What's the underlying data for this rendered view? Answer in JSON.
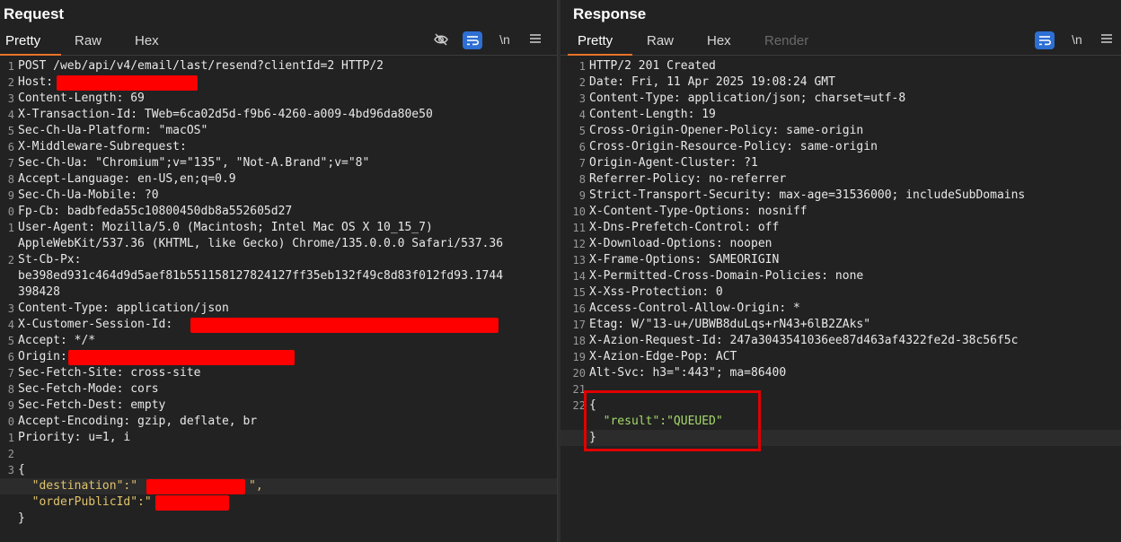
{
  "request": {
    "title": "Request",
    "tabs": [
      "Pretty",
      "Raw",
      "Hex"
    ],
    "newline_toggle": "\\n",
    "lines": [
      {
        "n": "1",
        "t": "POST /web/api/v4/email/last/resend?clientId=2 HTTP/2"
      },
      {
        "n": "2",
        "t": "Host:"
      },
      {
        "n": "3",
        "t": "Content-Length: 69"
      },
      {
        "n": "4",
        "t": "X-Transaction-Id: TWeb=6ca02d5d-f9b6-4260-a009-4bd96da80e50"
      },
      {
        "n": "5",
        "t": "Sec-Ch-Ua-Platform: \"macOS\""
      },
      {
        "n": "6",
        "t": "X-Middleware-Subrequest:"
      },
      {
        "n": "7",
        "t": "Sec-Ch-Ua: \"Chromium\";v=\"135\", \"Not-A.Brand\";v=\"8\""
      },
      {
        "n": "8",
        "t": "Accept-Language: en-US,en;q=0.9"
      },
      {
        "n": "9",
        "t": "Sec-Ch-Ua-Mobile: ?0"
      },
      {
        "n": "0",
        "t": "Fp-Cb: badbfeda55c10800450db8a552605d27"
      },
      {
        "n": "1",
        "t": "User-Agent: Mozilla/5.0 (Macintosh; Intel Mac OS X 10_15_7)"
      },
      {
        "n": "",
        "t": "AppleWebKit/537.36 (KHTML, like Gecko) Chrome/135.0.0.0 Safari/537.36"
      },
      {
        "n": "2",
        "t": "St-Cb-Px:"
      },
      {
        "n": "",
        "t": "be398ed931c464d9d5aef81b551158127824127ff35eb132f49c8d83f012fd93.1744"
      },
      {
        "n": "",
        "t": "398428"
      },
      {
        "n": "3",
        "t": "Content-Type: application/json"
      },
      {
        "n": "4",
        "t": "X-Customer-Session-Id:"
      },
      {
        "n": "5",
        "t": "Accept: */*"
      },
      {
        "n": "6",
        "t": "Origin:"
      },
      {
        "n": "7",
        "t": "Sec-Fetch-Site: cross-site"
      },
      {
        "n": "8",
        "t": "Sec-Fetch-Mode: cors"
      },
      {
        "n": "9",
        "t": "Sec-Fetch-Dest: empty"
      },
      {
        "n": "0",
        "t": "Accept-Encoding: gzip, deflate, br"
      },
      {
        "n": "1",
        "t": "Priority: u=1, i"
      },
      {
        "n": "2",
        "t": ""
      },
      {
        "n": "3",
        "t": "{"
      },
      {
        "n": "",
        "t": "  \"destination\":\"",
        "tail": "\","
      },
      {
        "n": "",
        "t": "  \"orderPublicId\":\""
      },
      {
        "n": "",
        "t": "}"
      }
    ]
  },
  "response": {
    "title": "Response",
    "tabs": [
      "Pretty",
      "Raw",
      "Hex",
      "Render"
    ],
    "newline_toggle": "\\n",
    "lines": [
      {
        "n": "1",
        "t": "HTTP/2 201 Created"
      },
      {
        "n": "2",
        "t": "Date: Fri, 11 Apr 2025 19:08:24 GMT"
      },
      {
        "n": "3",
        "t": "Content-Type: application/json; charset=utf-8"
      },
      {
        "n": "4",
        "t": "Content-Length: 19"
      },
      {
        "n": "5",
        "t": "Cross-Origin-Opener-Policy: same-origin"
      },
      {
        "n": "6",
        "t": "Cross-Origin-Resource-Policy: same-origin"
      },
      {
        "n": "7",
        "t": "Origin-Agent-Cluster: ?1"
      },
      {
        "n": "8",
        "t": "Referrer-Policy: no-referrer"
      },
      {
        "n": "9",
        "t": "Strict-Transport-Security: max-age=31536000; includeSubDomains"
      },
      {
        "n": "10",
        "t": "X-Content-Type-Options: nosniff"
      },
      {
        "n": "11",
        "t": "X-Dns-Prefetch-Control: off"
      },
      {
        "n": "12",
        "t": "X-Download-Options: noopen"
      },
      {
        "n": "13",
        "t": "X-Frame-Options: SAMEORIGIN"
      },
      {
        "n": "14",
        "t": "X-Permitted-Cross-Domain-Policies: none"
      },
      {
        "n": "15",
        "t": "X-Xss-Protection: 0"
      },
      {
        "n": "16",
        "t": "Access-Control-Allow-Origin: *"
      },
      {
        "n": "17",
        "t": "Etag: W/\"13-u+/UBWB8duLqs+rN43+6lB2ZAks\""
      },
      {
        "n": "18",
        "t": "X-Azion-Request-Id: 247a3043541036ee87d463af4322fe2d-38c56f5c"
      },
      {
        "n": "19",
        "t": "X-Azion-Edge-Pop: ACT"
      },
      {
        "n": "20",
        "t": "Alt-Svc: h3=\":443\"; ma=86400"
      },
      {
        "n": "21",
        "t": ""
      },
      {
        "n": "22",
        "t": "{"
      },
      {
        "n": "",
        "t": "  \"result\":\"QUEUED\""
      },
      {
        "n": "",
        "t": "}"
      }
    ]
  },
  "colors": {
    "background": "#222222",
    "accent_tab": "#e8742a",
    "highlight_box": "#e00000",
    "redaction": "#ff0000",
    "json_key": "#e0c46c",
    "json_string": "#a6d96a"
  }
}
